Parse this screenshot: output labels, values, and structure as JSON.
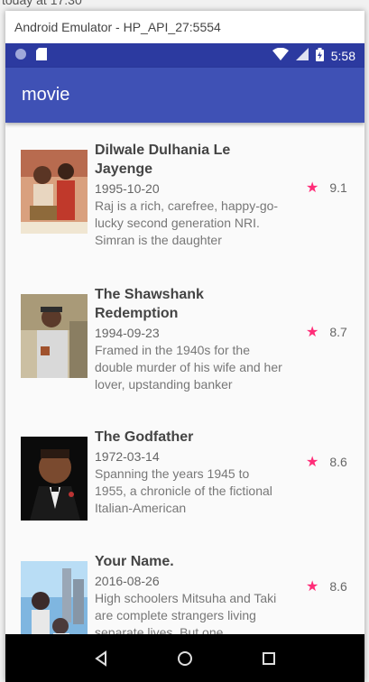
{
  "desktop": {
    "note": "today at 17:30"
  },
  "window": {
    "title": "Android Emulator - HP_API_27:5554"
  },
  "statusbar": {
    "time": "5:58"
  },
  "appbar": {
    "title": "movie"
  },
  "movies": [
    {
      "title": "Dilwale Dulhania Le Jayenge",
      "date": "1995-10-20",
      "overview": "Raj is a rich, carefree, happy-go-lucky second generation NRI. Simran is the daughter",
      "rating": "9.1"
    },
    {
      "title": "The Shawshank Redemption",
      "date": "1994-09-23",
      "overview": "Framed in the 1940s for the double murder of his wife and her lover, upstanding banker",
      "rating": "8.7"
    },
    {
      "title": "The Godfather",
      "date": "1972-03-14",
      "overview": "Spanning the years 1945 to 1955, a chronicle of the fictional Italian-American",
      "rating": "8.6"
    },
    {
      "title": "Your Name.",
      "date": "2016-08-26",
      "overview": "High schoolers Mitsuha and Taki are complete strangers living separate lives. But one",
      "rating": "8.6"
    }
  ],
  "colors": {
    "appbar": "#3f51b5",
    "statusbar": "#2c3aa0",
    "star": "#ff2d78"
  },
  "icons": [
    "circle-icon",
    "sd-card-icon",
    "wifi-icon",
    "signal-icon",
    "battery-icon",
    "star-icon",
    "back-icon",
    "home-icon",
    "recents-icon"
  ]
}
